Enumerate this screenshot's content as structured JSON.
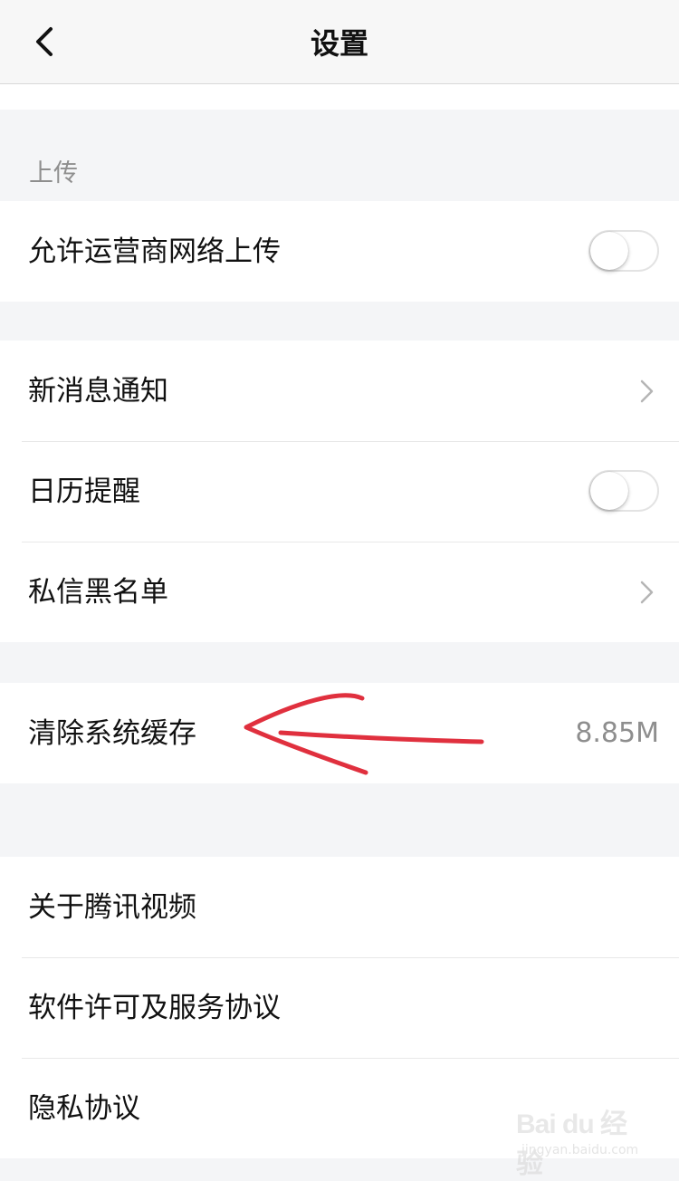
{
  "navbar": {
    "title": "设置",
    "back_icon": "chevron-left-icon"
  },
  "sections": {
    "upload_header": "上传"
  },
  "rows": {
    "allow_carrier_upload": {
      "label": "允许运营商网络上传",
      "toggle_on": false
    },
    "new_message_notification": {
      "label": "新消息通知"
    },
    "calendar_reminder": {
      "label": "日历提醒",
      "toggle_on": false
    },
    "dm_blacklist": {
      "label": "私信黑名单"
    },
    "clear_cache": {
      "label": "清除系统缓存",
      "value": "8.85M"
    },
    "about": {
      "label": "关于腾讯视频"
    },
    "license": {
      "label": "软件许可及服务协议"
    },
    "privacy": {
      "label": "隐私协议"
    }
  },
  "annotation": {
    "color": "#e0303e",
    "shape": "hand-drawn-arrow-pointing-left"
  },
  "watermark": {
    "logo_text": "Bai du 经验",
    "url": "jingyan.baidu.com"
  },
  "colors": {
    "background": "#f4f5f7",
    "secondary_text": "#8e8e8e",
    "divider": "#e8e8e8"
  }
}
